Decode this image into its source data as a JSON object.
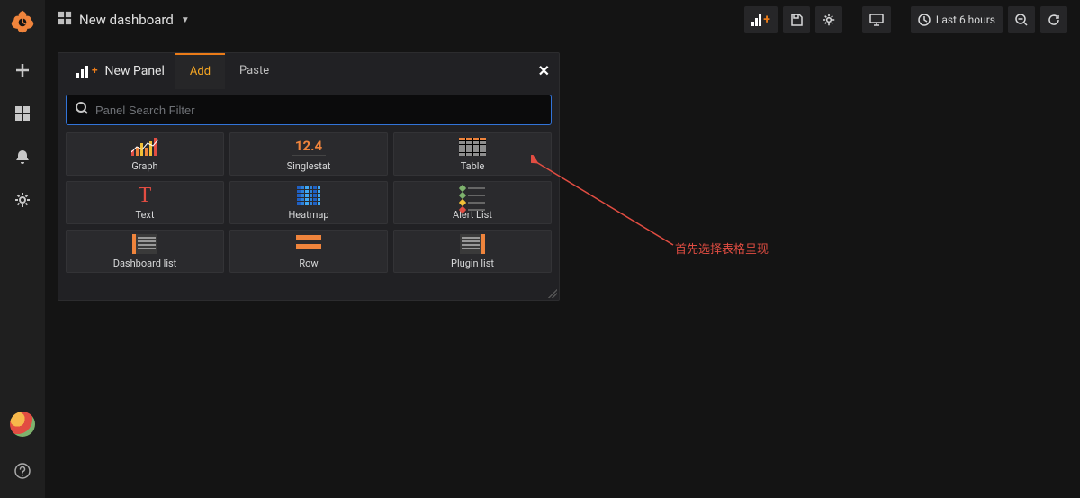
{
  "header": {
    "title": "New dashboard",
    "time_label": "Last 6 hours"
  },
  "panel_editor": {
    "title": "New Panel",
    "tab_add": "Add",
    "tab_paste": "Paste",
    "search_placeholder": "Panel Search Filter"
  },
  "panel_types": {
    "graph": "Graph",
    "singlestat": "Singlestat",
    "singlestat_value": "12.4",
    "table": "Table",
    "text": "Text",
    "heatmap": "Heatmap",
    "alertlist": "Alert List",
    "dashboardlist": "Dashboard list",
    "row": "Row",
    "pluginlist": "Plugin list"
  },
  "annotation": {
    "text": "首先选择表格呈现"
  }
}
